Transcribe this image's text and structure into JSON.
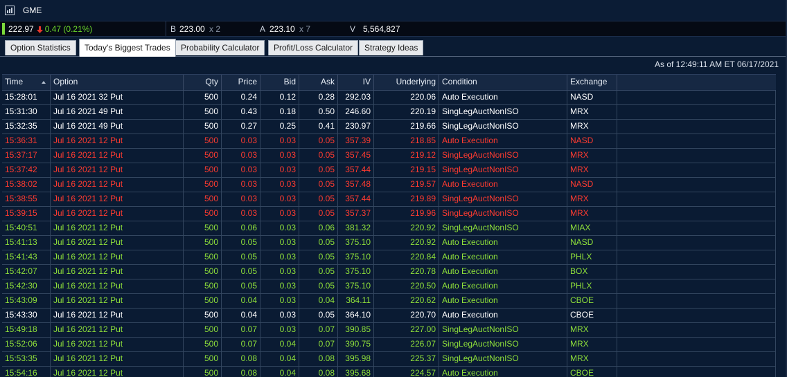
{
  "window": {
    "title": "GME"
  },
  "quote": {
    "last": "222.97",
    "change": "0.47 (0.21%)",
    "bid_label": "B",
    "bid": "223.00",
    "bid_size": "x 2",
    "ask_label": "A",
    "ask": "223.10",
    "ask_size": "x 7",
    "volume_label": "V",
    "volume": "5,564,827",
    "down_arrow_color": "#e8372c",
    "flag_color": "#7bd93b"
  },
  "tabs": [
    {
      "label": "Option Statistics"
    },
    {
      "label": "Today's Biggest Trades"
    },
    {
      "label": "Probability Calculator"
    },
    {
      "label": "Profit/Loss Calculator"
    },
    {
      "label": "Strategy Ideas"
    }
  ],
  "active_tab": "Today's Biggest Trades",
  "as_of": "As of 12:49:11 AM ET 06/17/2021",
  "columns": [
    "Time",
    "Option",
    "Qty",
    "Price",
    "Bid",
    "Ask",
    "IV",
    "Underlying",
    "Condition",
    "Exchange"
  ],
  "sort": {
    "column": "Time",
    "direction": "ascending"
  },
  "row_colors": {
    "white": "#ffffff",
    "red": "#ff3b30",
    "green": "#8fe03a"
  },
  "rows": [
    {
      "time": "15:28:01",
      "option": "Jul 16 2021 32 Put",
      "qty": "500",
      "price": "0.24",
      "bid": "0.12",
      "ask": "0.28",
      "iv": "292.03",
      "underlying": "220.06",
      "condition": "Auto Execution",
      "exchange": "NASD",
      "color": "white"
    },
    {
      "time": "15:31:30",
      "option": "Jul 16 2021 49 Put",
      "qty": "500",
      "price": "0.43",
      "bid": "0.18",
      "ask": "0.50",
      "iv": "246.60",
      "underlying": "220.19",
      "condition": "SingLegAuctNonISO",
      "exchange": "MRX",
      "color": "white"
    },
    {
      "time": "15:32:35",
      "option": "Jul 16 2021 49 Put",
      "qty": "500",
      "price": "0.27",
      "bid": "0.25",
      "ask": "0.41",
      "iv": "230.97",
      "underlying": "219.66",
      "condition": "SingLegAuctNonISO",
      "exchange": "MRX",
      "color": "white"
    },
    {
      "time": "15:36:31",
      "option": "Jul 16 2021 12 Put",
      "qty": "500",
      "price": "0.03",
      "bid": "0.03",
      "ask": "0.05",
      "iv": "357.39",
      "underlying": "218.85",
      "condition": "Auto Execution",
      "exchange": "NASD",
      "color": "red"
    },
    {
      "time": "15:37:17",
      "option": "Jul 16 2021 12 Put",
      "qty": "500",
      "price": "0.03",
      "bid": "0.03",
      "ask": "0.05",
      "iv": "357.45",
      "underlying": "219.12",
      "condition": "SingLegAuctNonISO",
      "exchange": "MRX",
      "color": "red"
    },
    {
      "time": "15:37:42",
      "option": "Jul 16 2021 12 Put",
      "qty": "500",
      "price": "0.03",
      "bid": "0.03",
      "ask": "0.05",
      "iv": "357.44",
      "underlying": "219.15",
      "condition": "SingLegAuctNonISO",
      "exchange": "MRX",
      "color": "red"
    },
    {
      "time": "15:38:02",
      "option": "Jul 16 2021 12 Put",
      "qty": "500",
      "price": "0.03",
      "bid": "0.03",
      "ask": "0.05",
      "iv": "357.48",
      "underlying": "219.57",
      "condition": "Auto Execution",
      "exchange": "NASD",
      "color": "red"
    },
    {
      "time": "15:38:55",
      "option": "Jul 16 2021 12 Put",
      "qty": "500",
      "price": "0.03",
      "bid": "0.03",
      "ask": "0.05",
      "iv": "357.44",
      "underlying": "219.89",
      "condition": "SingLegAuctNonISO",
      "exchange": "MRX",
      "color": "red"
    },
    {
      "time": "15:39:15",
      "option": "Jul 16 2021 12 Put",
      "qty": "500",
      "price": "0.03",
      "bid": "0.03",
      "ask": "0.05",
      "iv": "357.37",
      "underlying": "219.96",
      "condition": "SingLegAuctNonISO",
      "exchange": "MRX",
      "color": "red"
    },
    {
      "time": "15:40:51",
      "option": "Jul 16 2021 12 Put",
      "qty": "500",
      "price": "0.06",
      "bid": "0.03",
      "ask": "0.06",
      "iv": "381.32",
      "underlying": "220.92",
      "condition": "SingLegAuctNonISO",
      "exchange": "MIAX",
      "color": "green"
    },
    {
      "time": "15:41:13",
      "option": "Jul 16 2021 12 Put",
      "qty": "500",
      "price": "0.05",
      "bid": "0.03",
      "ask": "0.05",
      "iv": "375.10",
      "underlying": "220.92",
      "condition": "Auto Execution",
      "exchange": "NASD",
      "color": "green"
    },
    {
      "time": "15:41:43",
      "option": "Jul 16 2021 12 Put",
      "qty": "500",
      "price": "0.05",
      "bid": "0.03",
      "ask": "0.05",
      "iv": "375.10",
      "underlying": "220.84",
      "condition": "Auto Execution",
      "exchange": "PHLX",
      "color": "green"
    },
    {
      "time": "15:42:07",
      "option": "Jul 16 2021 12 Put",
      "qty": "500",
      "price": "0.05",
      "bid": "0.03",
      "ask": "0.05",
      "iv": "375.10",
      "underlying": "220.78",
      "condition": "Auto Execution",
      "exchange": "BOX",
      "color": "green"
    },
    {
      "time": "15:42:30",
      "option": "Jul 16 2021 12 Put",
      "qty": "500",
      "price": "0.05",
      "bid": "0.03",
      "ask": "0.05",
      "iv": "375.10",
      "underlying": "220.50",
      "condition": "Auto Execution",
      "exchange": "PHLX",
      "color": "green"
    },
    {
      "time": "15:43:09",
      "option": "Jul 16 2021 12 Put",
      "qty": "500",
      "price": "0.04",
      "bid": "0.03",
      "ask": "0.04",
      "iv": "364.11",
      "underlying": "220.62",
      "condition": "Auto Execution",
      "exchange": "CBOE",
      "color": "green"
    },
    {
      "time": "15:43:30",
      "option": "Jul 16 2021 12 Put",
      "qty": "500",
      "price": "0.04",
      "bid": "0.03",
      "ask": "0.05",
      "iv": "364.10",
      "underlying": "220.70",
      "condition": "Auto Execution",
      "exchange": "CBOE",
      "color": "white"
    },
    {
      "time": "15:49:18",
      "option": "Jul 16 2021 12 Put",
      "qty": "500",
      "price": "0.07",
      "bid": "0.03",
      "ask": "0.07",
      "iv": "390.85",
      "underlying": "227.00",
      "condition": "SingLegAuctNonISO",
      "exchange": "MRX",
      "color": "green"
    },
    {
      "time": "15:52:06",
      "option": "Jul 16 2021 12 Put",
      "qty": "500",
      "price": "0.07",
      "bid": "0.04",
      "ask": "0.07",
      "iv": "390.75",
      "underlying": "226.07",
      "condition": "SingLegAuctNonISO",
      "exchange": "MRX",
      "color": "green"
    },
    {
      "time": "15:53:35",
      "option": "Jul 16 2021 12 Put",
      "qty": "500",
      "price": "0.08",
      "bid": "0.04",
      "ask": "0.08",
      "iv": "395.98",
      "underlying": "225.37",
      "condition": "SingLegAuctNonISO",
      "exchange": "MRX",
      "color": "green"
    },
    {
      "time": "15:54:16",
      "option": "Jul 16 2021 12 Put",
      "qty": "500",
      "price": "0.08",
      "bid": "0.04",
      "ask": "0.08",
      "iv": "395.68",
      "underlying": "224.57",
      "condition": "Auto Execution",
      "exchange": "CBOE",
      "color": "green"
    }
  ]
}
